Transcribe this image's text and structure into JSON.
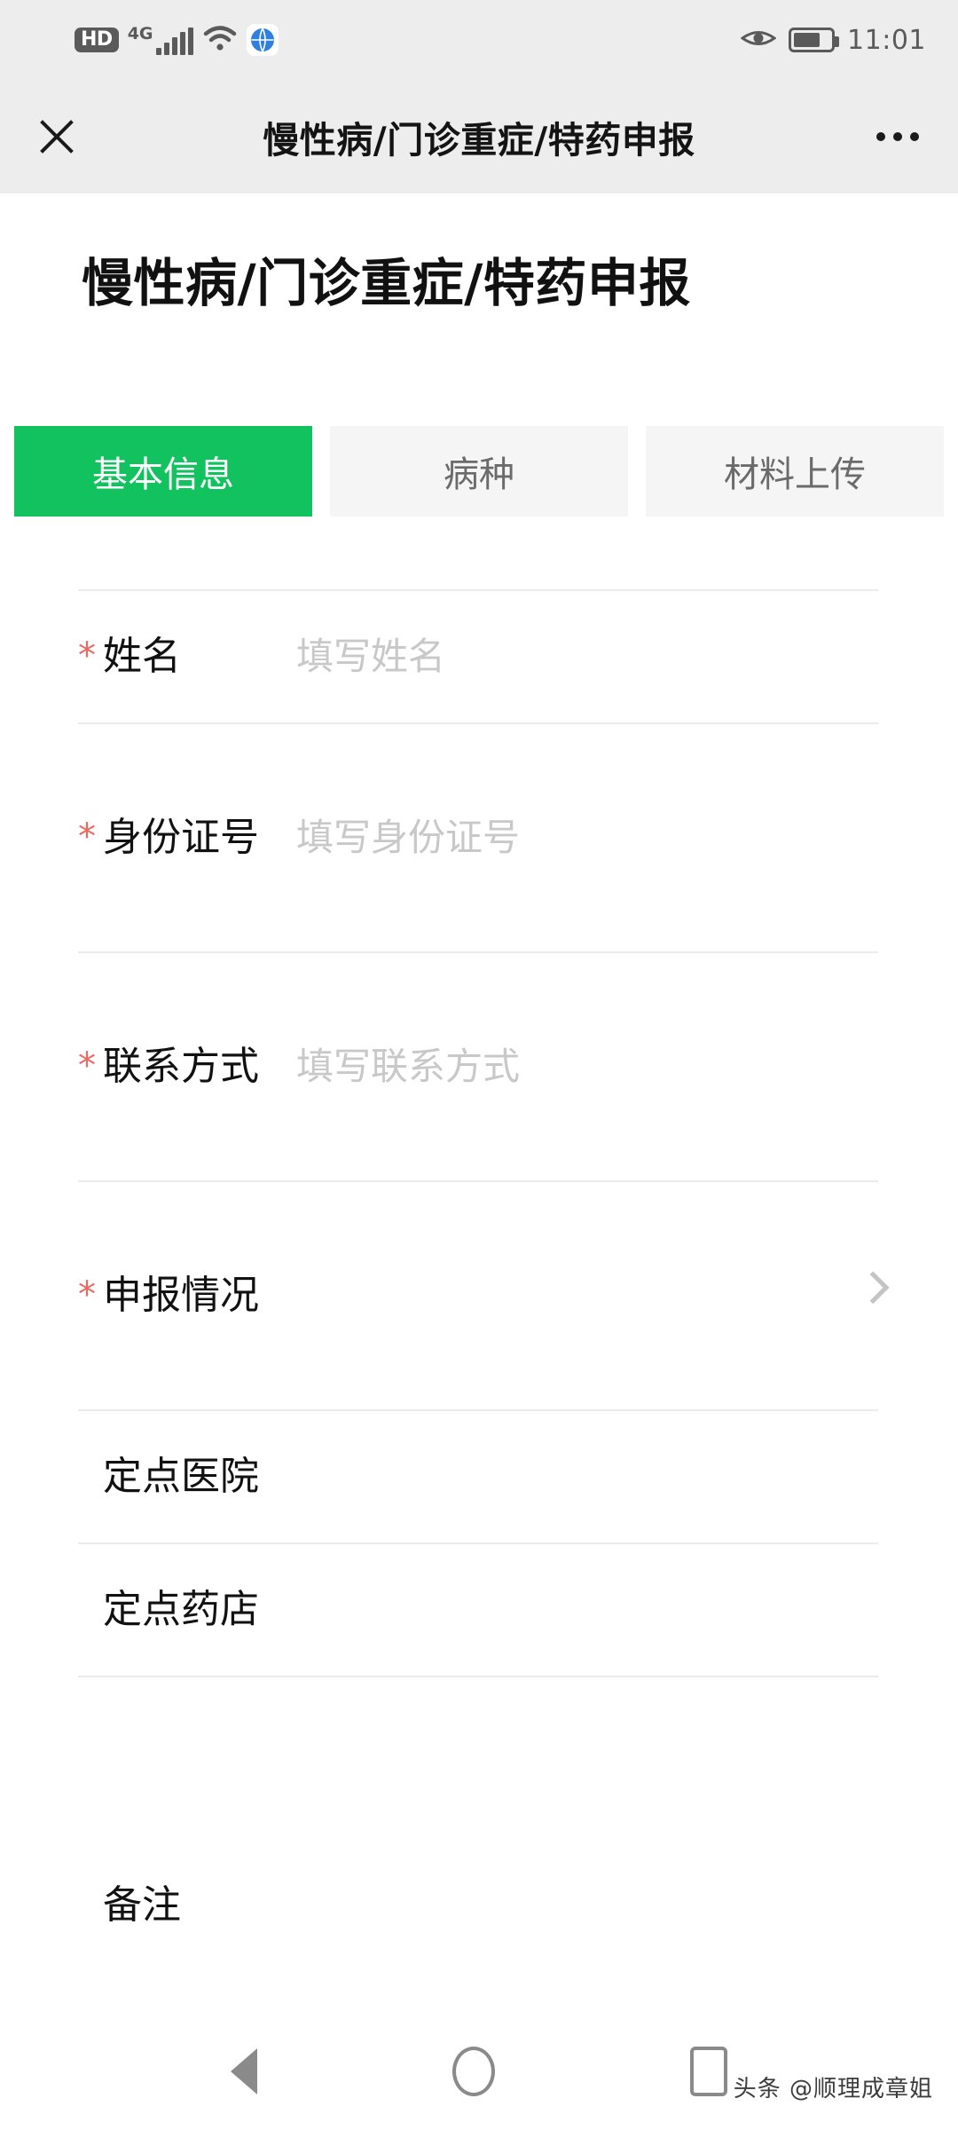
{
  "status_bar": {
    "hd_badge": "HD",
    "network_type": "4G",
    "signal_icon": "signal-bars-icon",
    "wifi_icon": "wifi-icon",
    "globe_icon": "globe-icon",
    "eye_icon": "eye-icon",
    "battery_icon": "battery-icon",
    "battery_level_percent": "72",
    "time": "11:01"
  },
  "navbar": {
    "close_icon": "close-icon",
    "title": "慢性病/门诊重症/特药申报",
    "more_icon": "more-options-icon"
  },
  "page": {
    "title": "慢性病/门诊重症/特药申报"
  },
  "tabs": {
    "active_index": 0,
    "active_color": "#11c25f",
    "inactive_bg": "#f5f5f5",
    "items": [
      {
        "label": "基本信息",
        "active": true
      },
      {
        "label": "病种",
        "active": false
      },
      {
        "label": "材料上传",
        "active": false
      }
    ]
  },
  "form": {
    "required_mark": "*",
    "required_color": "#e96a63",
    "rows": [
      {
        "label": "姓名",
        "required": true,
        "placeholder": "填写姓名",
        "chevron": false
      },
      {
        "label": "身份证号",
        "required": true,
        "placeholder": "填写身份证号",
        "chevron": false
      },
      {
        "label": "联系方式",
        "required": true,
        "placeholder": "填写联系方式",
        "chevron": false
      },
      {
        "label": "申报情况",
        "required": true,
        "placeholder": "",
        "chevron": true
      },
      {
        "label": "定点医院",
        "required": false,
        "placeholder": "",
        "chevron": false
      },
      {
        "label": "定点药店",
        "required": false,
        "placeholder": "",
        "chevron": false
      },
      {
        "label": "备注",
        "required": false,
        "placeholder": "",
        "chevron": false
      }
    ]
  },
  "bottom_nav": {
    "back_icon": "back-triangle-icon",
    "home_icon": "home-circle-icon",
    "recents_icon": "recents-square-icon"
  },
  "watermark": {
    "text": "头条 @顺理成章姐"
  }
}
